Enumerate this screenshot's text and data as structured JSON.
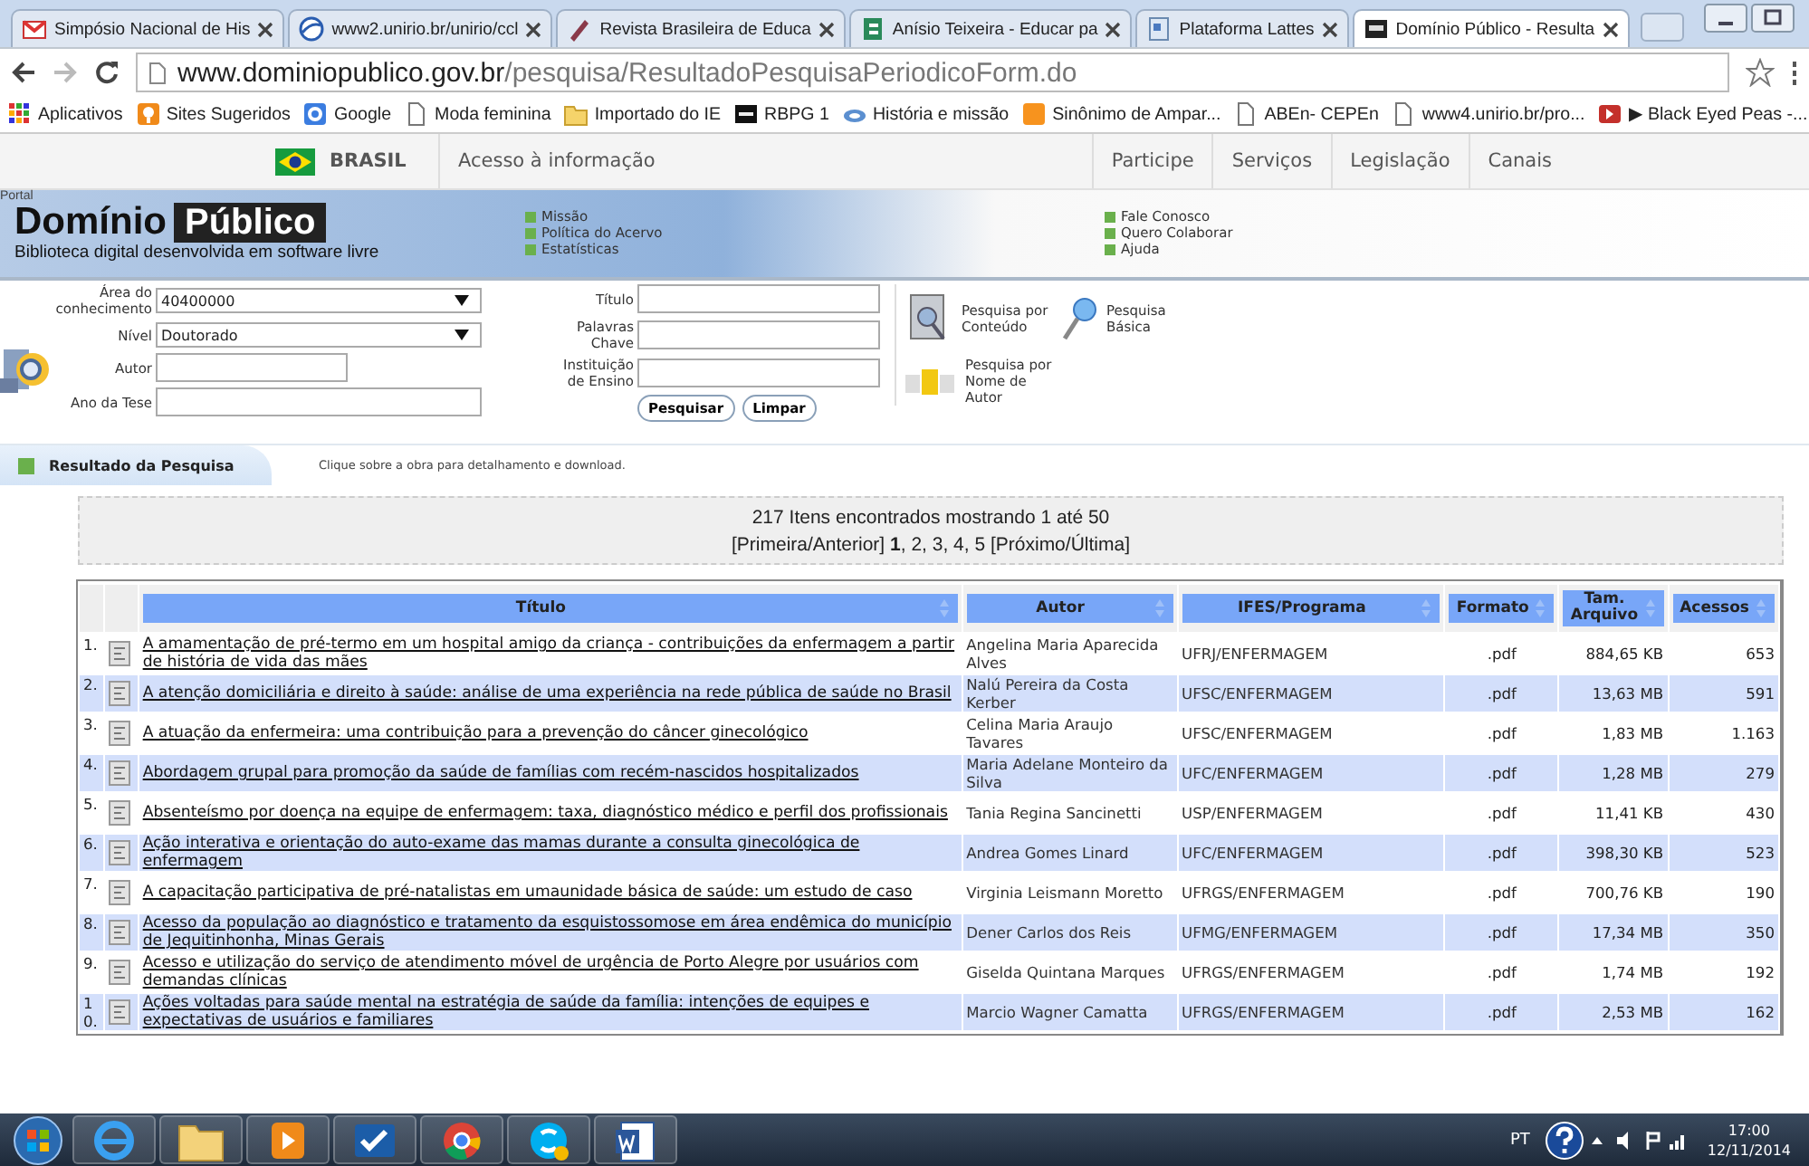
{
  "browser": {
    "tabs": [
      {
        "title": "Simpósio Nacional de His",
        "kind": "mail",
        "selected": false
      },
      {
        "title": "www2.unirio.br/unirio/ccl",
        "kind": "globe",
        "selected": false
      },
      {
        "title": "Revista Brasileira de Educa",
        "kind": "pen",
        "selected": false
      },
      {
        "title": "Anísio Teixeira - Educar pa",
        "kind": "green",
        "selected": false
      },
      {
        "title": "Plataforma Lattes",
        "kind": "page",
        "selected": false
      },
      {
        "title": "Domínio Público - Resulta",
        "kind": "dark",
        "selected": true
      }
    ],
    "address": {
      "host": "www.dominiopublico.gov.br",
      "path": "/pesquisa/ResultadoPesquisaPeriodicoForm.do"
    },
    "bookmarks": [
      {
        "label": "Aplicativos",
        "kind": "apps"
      },
      {
        "label": "Sites Sugeridos",
        "kind": "bulb"
      },
      {
        "label": "Google",
        "kind": "blue"
      },
      {
        "label": "Moda feminina",
        "kind": "page"
      },
      {
        "label": "Importado do IE",
        "kind": "folder"
      },
      {
        "label": "RBPG 1",
        "kind": "dark"
      },
      {
        "label": "História e missão",
        "kind": "cloud"
      },
      {
        "label": "Sinônimo de Ampar...",
        "kind": "orange"
      },
      {
        "label": "ABEn- CEPEn",
        "kind": "page"
      },
      {
        "label": "www4.unirio.br/pro...",
        "kind": "page"
      },
      {
        "label": "▶ Black Eyed Peas -...",
        "kind": "video"
      }
    ]
  },
  "gov_bar": {
    "country": "BRASIL",
    "access": "Acesso à informação",
    "links": [
      "Participe",
      "Serviços",
      "Legislação",
      "Canais"
    ]
  },
  "portal": {
    "overline": "Portal",
    "logo_first": "Domínio",
    "logo_second": "Público",
    "tagline": "Biblioteca digital desenvolvida em software livre",
    "links_left": [
      "Missão",
      "Política do Acervo",
      "Estatísticas"
    ],
    "links_right": [
      "Fale Conosco",
      "Quero Colaborar",
      "Ajuda"
    ]
  },
  "search_form": {
    "left_fields": [
      {
        "label": "Área do conhecimento",
        "kind": "select",
        "value": "40400000"
      },
      {
        "label": "Nível",
        "kind": "select",
        "value": "Doutorado"
      },
      {
        "label": "Autor",
        "kind": "text"
      },
      {
        "label": "Ano da Tese",
        "kind": "text"
      }
    ],
    "right_fields": [
      {
        "label": "Título",
        "kind": "text"
      },
      {
        "label": "Palavras Chave",
        "kind": "text"
      },
      {
        "label": "Instituição de Ensino",
        "kind": "text"
      }
    ],
    "buttons": [
      "Pesquisar",
      "Limpar"
    ],
    "shortcuts": [
      {
        "label": "Pesquisa por Conteúdo",
        "kind": "document"
      },
      {
        "label": "Pesquisa Básica",
        "kind": "magnifier"
      },
      {
        "label": "Pesquisa por Nome de Autor",
        "kind": "letters"
      }
    ]
  },
  "results": {
    "heading": "Resultado da Pesquisa",
    "hint": "Clique sobre a obra para detalhamento e download.",
    "summary": "217 Itens encontrados mostrando 1 até 50",
    "pagination": "[Primeira/Anterior] **1**, 2, 3, 4, 5 [Próximo/Última]"
  },
  "table": {
    "columns": [
      "Título",
      "Autor",
      "IFES/Programa",
      "Formato",
      "Tam. Arquivo",
      "Acessos"
    ],
    "rows": [
      {
        "number": "1.",
        "title": "A amamentação de pré-termo em um hospital amigo da criança - contribuições da enfermagem a partir de história de vida das mães",
        "author": "Angelina Maria Aparecida Alves",
        "program": "UFRJ/ENFERMAGEM",
        "format": ".pdf",
        "size": "884,65 KB",
        "accesses": "653"
      },
      {
        "number": "2.",
        "title": "A atenção domiciliária e direito à saúde: análise de uma experiência na rede pública de saúde no Brasil",
        "author": "Nalú Pereira da Costa Kerber",
        "program": "UFSC/ENFERMAGEM",
        "format": ".pdf",
        "size": "13,63 MB",
        "accesses": "591"
      },
      {
        "number": "3.",
        "title": "A atuação da enfermeira: uma contribuição para a prevenção do câncer ginecológico",
        "author": "Celina Maria Araujo Tavares",
        "program": "UFSC/ENFERMAGEM",
        "format": ".pdf",
        "size": "1,83 MB",
        "accesses": "1.163"
      },
      {
        "number": "4.",
        "title": "Abordagem grupal para promoção da saúde de famílias com recém-nascidos hospitalizados",
        "author": "Maria Adelane Monteiro da Silva",
        "program": "UFC/ENFERMAGEM",
        "format": ".pdf",
        "size": "1,28 MB",
        "accesses": "279"
      },
      {
        "number": "5.",
        "title": "Absenteísmo por doença na equipe de enfermagem: taxa, diagnóstico médico e perfil dos profissionais",
        "author": "Tania Regina Sancinetti",
        "program": "USP/ENFERMAGEM",
        "format": ".pdf",
        "size": "11,41 KB",
        "accesses": "430"
      },
      {
        "number": "6.",
        "title": "Ação interativa e orientação do auto-exame das mamas durante a consulta ginecológica de enfermagem",
        "author": "Andrea Gomes Linard",
        "program": "UFC/ENFERMAGEM",
        "format": ".pdf",
        "size": "398,30 KB",
        "accesses": "523"
      },
      {
        "number": "7.",
        "title": "A capacitação participativa de pré-natalistas em umaunidade básica de saúde: um estudo de caso",
        "author": "Virginia Leismann Moretto",
        "program": "UFRGS/ENFERMAGEM",
        "format": ".pdf",
        "size": "700,76 KB",
        "accesses": "190"
      },
      {
        "number": "8.",
        "title": "Acesso da população ao diagnóstico e tratamento da esquistossomose em área endêmica do município de Jequitinhonha, Minas Gerais",
        "author": "Dener Carlos dos Reis",
        "program": "UFMG/ENFERMAGEM",
        "format": ".pdf",
        "size": "17,34 MB",
        "accesses": "350"
      },
      {
        "number": "9.",
        "title": "Acesso e utilização do serviço de atendimento móvel de urgência de Porto Alegre por usuários com demandas clínicas",
        "author": "Giselda Quintana Marques",
        "program": "UFRGS/ENFERMAGEM",
        "format": ".pdf",
        "size": "1,74 MB",
        "accesses": "192"
      },
      {
        "number": "10.",
        "title": "Ações voltadas para saúde mental na estratégia de saúde da família: intenções de equipes e expectativas de usuários e familiares",
        "author": "Marcio Wagner Camatta",
        "program": "UFRGS/ENFERMAGEM",
        "format": ".pdf",
        "size": "2,53 MB",
        "accesses": "162"
      }
    ]
  },
  "taskbar": {
    "apps": [
      {
        "kind": "ie"
      },
      {
        "kind": "folder"
      },
      {
        "kind": "media"
      },
      {
        "kind": "check"
      },
      {
        "kind": "chrome"
      },
      {
        "kind": "skype"
      },
      {
        "kind": "word"
      }
    ],
    "language": "PT",
    "time": "17:00",
    "date": "12/11/2014"
  }
}
